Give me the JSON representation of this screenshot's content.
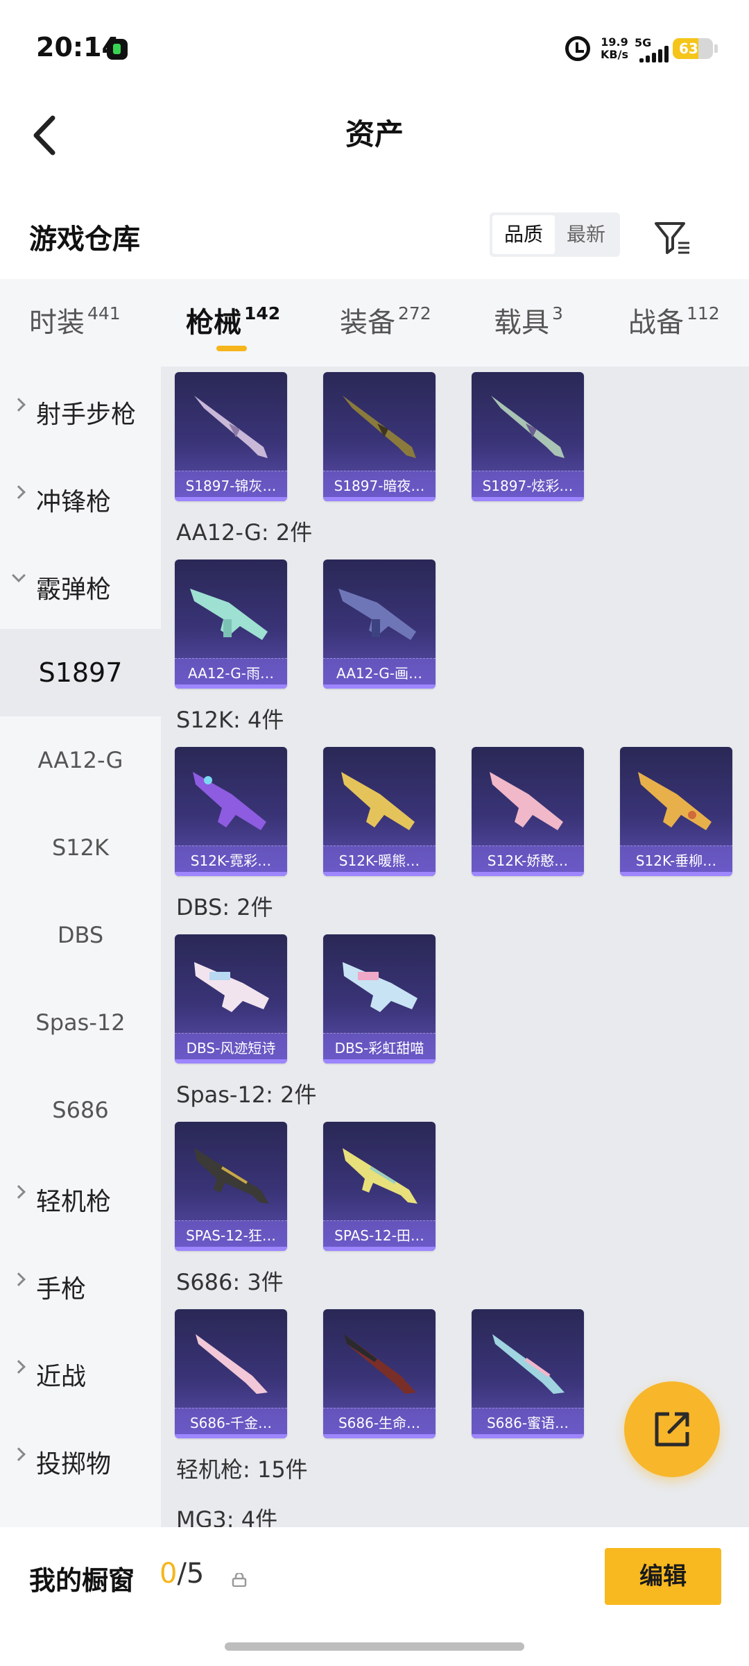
{
  "status_bar": {
    "time": "20:14",
    "speed_value": "19.9",
    "speed_unit": "KB/s",
    "network": "5G",
    "battery": "63",
    "battery_level": 0.63,
    "battery_color": "#f5c51a"
  },
  "header": {
    "title": "资产"
  },
  "warehouse": {
    "title": "游戏仓库",
    "sort_options": [
      "品质",
      "最新"
    ],
    "active_sort": "品质"
  },
  "tabs": [
    {
      "label": "时装",
      "count": "441"
    },
    {
      "label": "枪械",
      "count": "142",
      "active": true
    },
    {
      "label": "装备",
      "count": "272"
    },
    {
      "label": "载具",
      "count": "3"
    },
    {
      "label": "战备",
      "count": "112"
    }
  ],
  "sidebar": {
    "categories": {
      "marksman": "射手步枪",
      "smg": "冲锋枪",
      "shotgun": "霰弹枪",
      "lmg": "轻机枪",
      "pistol": "手枪",
      "melee": "近战",
      "throwable": "投掷物"
    },
    "shotgun_subitems": [
      "S1897",
      "AA12-G",
      "S12K",
      "DBS",
      "Spas-12",
      "S686"
    ],
    "active_sub": "S1897"
  },
  "groups": {
    "aa12g_title": "AA12-G: 2件",
    "s12k_title": "S12K: 4件",
    "dbs_title": "DBS: 2件",
    "spas12_title": "Spas-12: 2件",
    "s686_title": "S686: 3件",
    "lmg_title": "轻机枪: 15件",
    "next_title_partial": "MG3: 4件"
  },
  "cards": {
    "s1897": [
      "S1897-锦灰…",
      "S1897-暗夜…",
      "S1897-炫彩…"
    ],
    "aa12g": [
      "AA12-G-雨…",
      "AA12-G-画…"
    ],
    "s12k": [
      "S12K-霓彩…",
      "S12K-暖熊…",
      "S12K-娇憨…",
      "S12K-垂柳…"
    ],
    "dbs": [
      "DBS-风迹短诗",
      "DBS-彩虹甜喵"
    ],
    "spas12": [
      "SPAS-12-狂…",
      "SPAS-12-田…"
    ],
    "s686": [
      "S686-千金…",
      "S686-生命…",
      "S686-蜜语…"
    ]
  },
  "bottom_bar": {
    "label": "我的橱窗",
    "current": "0",
    "total": "/5",
    "edit_label": "编辑"
  },
  "colors": {
    "accent": "#f6b51b",
    "card_bg": "#3a3478",
    "sidebar_bg": "#f5f6f8",
    "content_bg": "#e8eaee"
  },
  "icons": [
    "back-chevron-icon",
    "filter-icon",
    "share-out-icon",
    "lock-icon",
    "alarm-icon",
    "signal-icon",
    "battery-icon"
  ]
}
